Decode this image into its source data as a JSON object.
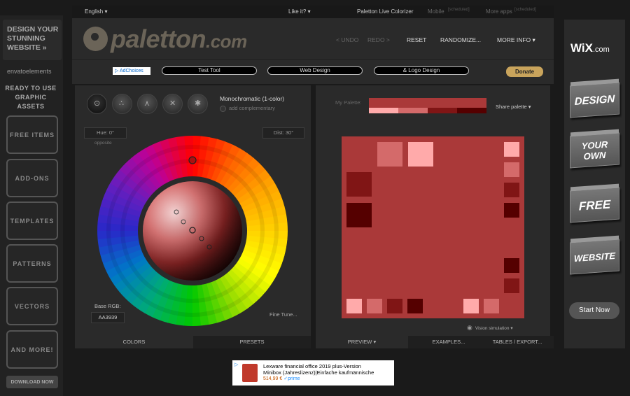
{
  "topbar": {
    "language": "English ▾",
    "like_it": "Like it? ▾",
    "app_name": "Paletton Live Colorizer",
    "mobile": "Mobile",
    "mobile_badge": "[scheduled]",
    "more_apps": "More apps",
    "more_apps_badge": "[scheduled]"
  },
  "header": {
    "logo_main": "paletton",
    "logo_com": ".com",
    "undo": "< UNDO",
    "redo": "REDO >",
    "reset": "RESET",
    "randomize": "RANDOMIZE...",
    "more_info": "MORE INFO ▾"
  },
  "linkbar": {
    "adchoices": "▷ AdChoices",
    "links": [
      "Test Tool",
      "Web Design",
      "& Logo Design"
    ],
    "donate": "Donate"
  },
  "colors_panel": {
    "scheme_label": "Monochromatic (1-color)",
    "add_complementary": "add complementary",
    "hue": "Hue: 0°",
    "dist": "Dist: 30°",
    "opposite": "opposite",
    "base_rgb_label": "Base RGB:",
    "base_rgb_value": "AA3939",
    "fine_tune": "Fine Tune...",
    "tab_colors": "COLORS",
    "tab_presets": "PRESETS"
  },
  "palette_panel": {
    "my_palette_label": "My Palette:",
    "share": "Share palette ▾",
    "vision": "Vision simulation ▾",
    "tab_preview": "PREVIEW ▾",
    "tab_examples": "EXAMPLES...",
    "tab_tables": "TABLES / EXPORT...",
    "colors": {
      "base": "#AA3939",
      "light1": "#D46A6A",
      "light2": "#FFAAAA",
      "dark1": "#801515",
      "dark2": "#550000"
    }
  },
  "left_ad": {
    "headline": "DESIGN YOUR STUNNING WEBSITE »",
    "envato": "envatoelements",
    "ready": "READY TO USE GRAPHIC ASSETS",
    "items": [
      "FREE ITEMS",
      "ADD-ONS",
      "TEMPLATES",
      "PATTERNS",
      "VECTORS",
      "AND MORE!"
    ],
    "download": "DOWNLOAD NOW"
  },
  "right_ad": {
    "logo": "WiX",
    "logo_com": ".com",
    "cards": [
      "DESIGN",
      "YOUR OWN",
      "FREE",
      "WEBSITE"
    ],
    "cta": "Start Now"
  },
  "bottom_ad": {
    "adinfo_icon": "▷",
    "line1": "Lexware financial office 2019 plus-Version",
    "line2": "Minibox (Jahreslizenz)|Einfache kaufmännische",
    "price": "514,99 €",
    "prime": "✓prime"
  }
}
